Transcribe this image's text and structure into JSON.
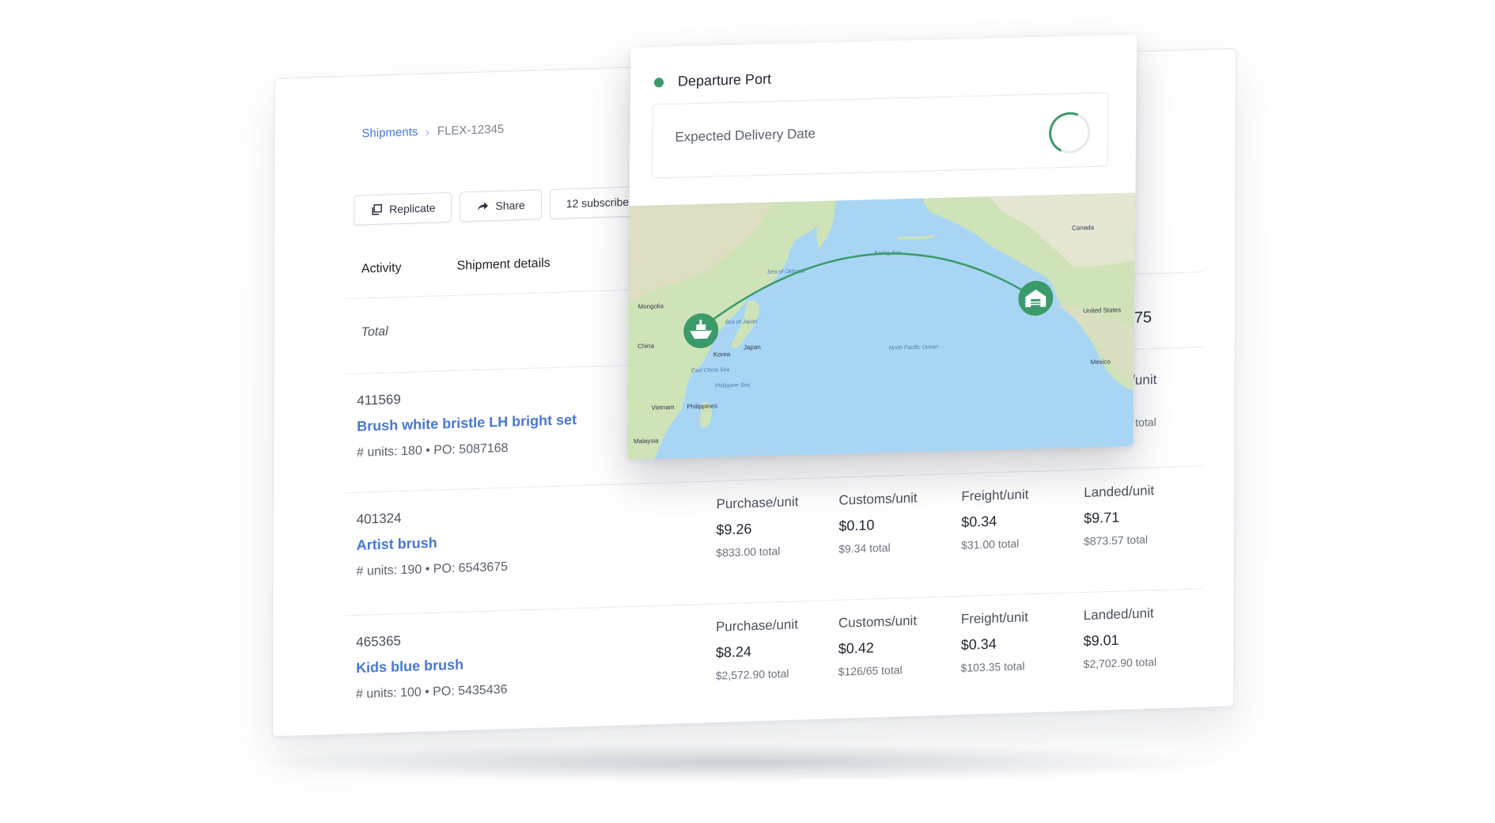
{
  "breadcrumb": {
    "root": "Shipments",
    "current": "FLEX-12345"
  },
  "toolbar": {
    "replicate": "Replicate",
    "share": "Share",
    "subscribers": "12 subscribers"
  },
  "tabs": [
    "Activity",
    "Shipment details"
  ],
  "summary": {
    "total_label": "Total",
    "total_value_partial": "01.75"
  },
  "first_row_partial": {
    "landed_label_partial": "d/unit",
    "landed_total_partial": "9 total"
  },
  "rows": [
    {
      "sku": "411569",
      "name": "Brush white bristle LH bright set",
      "meta": "# units: 180 • PO: 5087168"
    },
    {
      "sku": "401324",
      "name": "Artist brush",
      "meta": "# units: 190 • PO: 6543675",
      "purchase": {
        "label": "Purchase/unit",
        "value": "$9.26",
        "total": "$833.00 total"
      },
      "customs": {
        "label": "Customs/unit",
        "value": "$0.10",
        "total": "$9.34 total"
      },
      "freight": {
        "label": "Freight/unit",
        "value": "$0.34",
        "total": "$31.00 total"
      },
      "landed": {
        "label": "Landed/unit",
        "value": "$9.71",
        "total": "$873.57 total"
      }
    },
    {
      "sku": "465365",
      "name": "Kids blue brush",
      "meta": "# units: 100 • PO: 5435436",
      "purchase": {
        "label": "Purchase/unit",
        "value": "$8.24",
        "total": "$2,572.90 total"
      },
      "customs": {
        "label": "Customs/unit",
        "value": "$0.42",
        "total": "$126/65 total"
      },
      "freight": {
        "label": "Freight/unit",
        "value": "$0.34",
        "total": "$103.35 total"
      },
      "landed": {
        "label": "Landed/unit",
        "value": "$9.01",
        "total": "$2,702.90 total"
      }
    }
  ],
  "popup": {
    "departure_label": "Departure Port",
    "expected_delivery_label": "Expected Delivery Date",
    "status_color": "#3a9a6a"
  },
  "map": {
    "labels": {
      "mongolia": "Mongolia",
      "china": "China",
      "japan": "Japan",
      "korea": "Korea",
      "philippines": "Philippines",
      "vietnam": "Vietnam",
      "malaysia": "Malaysia",
      "canada": "Canada",
      "united_states": "United States",
      "mexico": "Mexico",
      "north_pacific": "North Pacific Ocean",
      "bering_sea": "Bering Sea",
      "sea_of_okhotsk": "Sea of Okhotsk",
      "sea_of_japan": "Sea of Japan",
      "east_china_sea": "East China Sea",
      "philippine_sea": "Philippine Sea"
    },
    "origin_icon": "ship-icon",
    "destination_icon": "warehouse-icon",
    "route_color": "#3a9a6a"
  }
}
